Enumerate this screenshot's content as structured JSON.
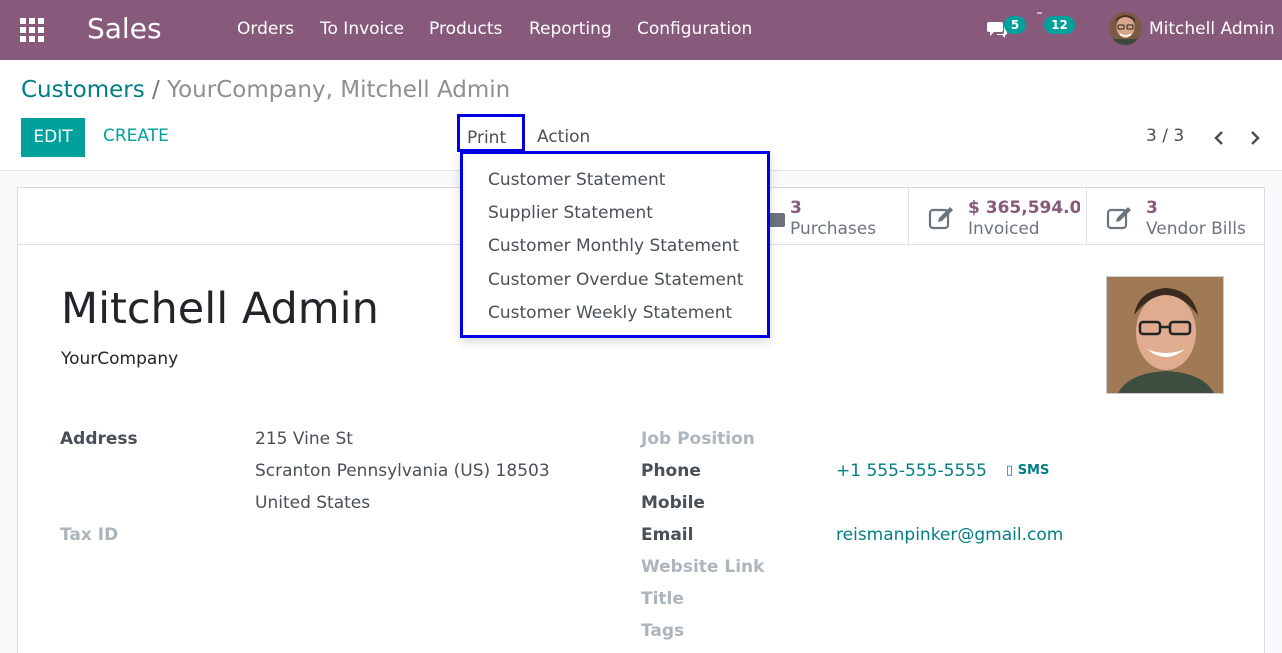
{
  "navbar": {
    "app_name": "Sales",
    "menu": [
      "Orders",
      "To Invoice",
      "Products",
      "Reporting",
      "Configuration"
    ],
    "messages_count": "5",
    "activities_count": "12",
    "user_name": "Mitchell Admin",
    "bg_color": "#875a7b"
  },
  "breadcrumb": {
    "parent": "Customers",
    "separator": "/",
    "current": "YourCompany, Mitchell Admin"
  },
  "toolbar": {
    "edit_label": "EDIT",
    "create_label": "CREATE",
    "print_label": "Print",
    "action_label": "Action",
    "pager": "3 / 3"
  },
  "print_menu": {
    "items": [
      "Customer Statement",
      "Supplier Statement",
      "Customer Monthly Statement",
      "Customer Overdue Statement",
      "Customer Weekly Statement"
    ]
  },
  "stat_buttons": [
    {
      "value": "3",
      "label": "Purchases",
      "icon": "purchases-icon"
    },
    {
      "value": "$ 365,594.0",
      "label": "Invoiced",
      "icon": "invoice-edit-icon"
    },
    {
      "value": "3",
      "label": "Vendor Bills",
      "icon": "vendor-bills-edit-icon"
    }
  ],
  "partner": {
    "name": "Mitchell Admin",
    "company": "YourCompany"
  },
  "fields": {
    "address_label": "Address",
    "address_line1": "215 Vine St",
    "address_line2": "Scranton  Pennsylvania (US)  18503",
    "address_line3": "United States",
    "tax_id_label": "Tax ID",
    "job_position_label": "Job Position",
    "phone_label": "Phone",
    "phone_value": "+1 555-555-5555",
    "sms_label": "SMS",
    "mobile_label": "Mobile",
    "email_label": "Email",
    "email_value": "reismanpinker@gmail.com",
    "website_label": "Website Link",
    "title_label": "Title",
    "tags_label": "Tags"
  },
  "colors": {
    "primary": "#00a09d",
    "link": "#017e84",
    "highlight": "#0000e6"
  }
}
